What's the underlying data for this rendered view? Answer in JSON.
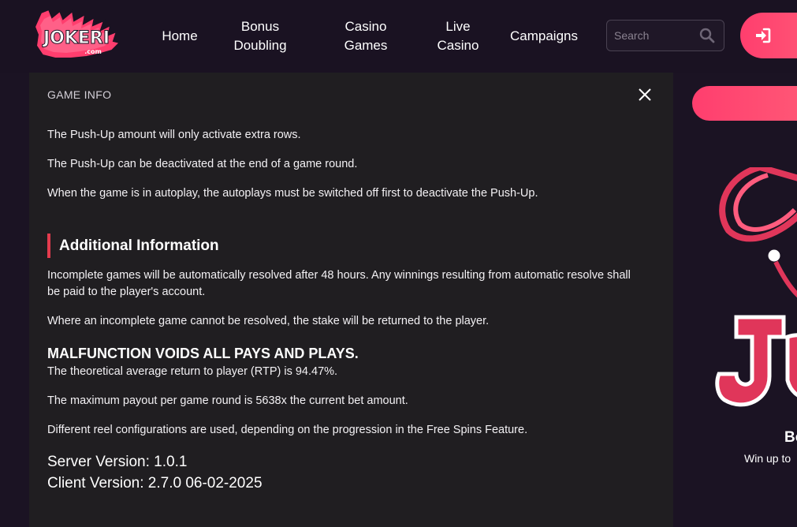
{
  "brand": {
    "logo_text": "JOKERI",
    "logo_domain": ".com"
  },
  "nav": {
    "home": "Home",
    "bonus_line1": "Bonus",
    "bonus_line2": "Doubling",
    "casino_line1": "Casino",
    "casino_line2": "Games",
    "live_line1": "Live",
    "live_line2": "Casino",
    "campaigns": "Campaigns"
  },
  "search": {
    "placeholder": "Search",
    "icon": "search-icon"
  },
  "login": {
    "icon": "login-icon"
  },
  "game_info": {
    "title": "GAME INFO",
    "paragraphs": [
      "The Push-Up amount will only activate extra rows.",
      "The Push-Up can be deactivated at the end of a game round.",
      "When the game is in autoplay, the autoplays must be switched off first to deactivate the Push-Up."
    ],
    "section_title": "Additional Information",
    "additional": [
      "Incomplete games will be automatically resolved after 48 hours. Any winnings resulting from automatic resolve shall be paid to the player's account.",
      "Where an incomplete game cannot be resolved, the stake will be returned to the player."
    ],
    "malfunction": "MALFUNCTION VOIDS ALL PAYS AND PLAYS.",
    "details": [
      "The theoretical average return to player (RTP) is 94.47%.",
      "The maximum payout per game round is 5638x the current bet amount.",
      "Different reel configurations are used, depending on the progression in the Free Spins Feature."
    ],
    "server_version": "Server Version: 1.0.1",
    "client_version": "Client Version: 2.7.0 06-02-2025"
  },
  "promo": {
    "title": "Bo",
    "subtitle": "Win up to"
  },
  "colors": {
    "accent": "#ff3e6e",
    "section_bar": "#e33b4d",
    "panel_bg": "#201e21",
    "page_bg": "#1b1323"
  }
}
